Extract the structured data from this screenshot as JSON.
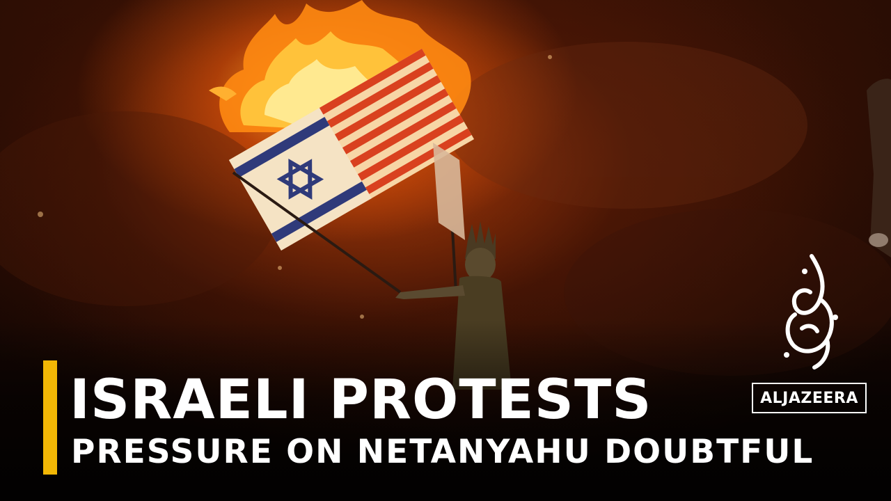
{
  "caption": {
    "headline": "ISRAELI PROTESTS",
    "subheadline": "PRESSURE ON NETANYAHU DOUBTFUL"
  },
  "logo": {
    "wordmark": "ALJAZEERA"
  },
  "colors": {
    "accent_bar": "#f2b705",
    "caption_text": "#ffffff",
    "fire": "#ff9a1f"
  }
}
